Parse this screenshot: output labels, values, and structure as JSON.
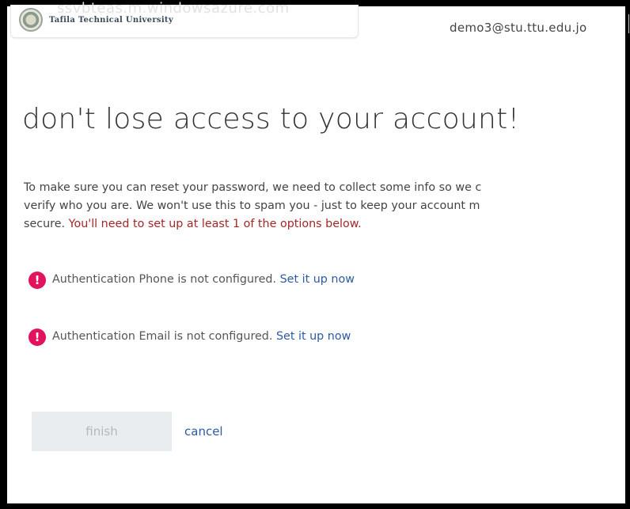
{
  "header": {
    "ghost_url": "ssvbteas.m.windowsazure.com",
    "org_name": "Tafila Technical University",
    "user_email": "demo3@stu.ttu.edu.jo"
  },
  "main": {
    "title": "don't lose access to your account!",
    "intro_lines": [
      "To make sure you can reset your password, we need to collect some info so we c",
      "verify who you are. We won't use this to spam you - just to keep your account m"
    ],
    "intro_last_prefix": "secure. ",
    "intro_warning": "You'll need to set up at least 1 of the options below.",
    "methods": [
      {
        "status": "Authentication Phone is not configured.",
        "action": "Set it up now"
      },
      {
        "status": "Authentication Email is not configured.",
        "action": "Set it up now"
      }
    ],
    "finish_label": "finish",
    "cancel_label": "cancel",
    "alert_glyph": "!"
  },
  "colors": {
    "alert": "#e3125e",
    "link": "#2d5aa0",
    "warning": "#a4262c"
  }
}
